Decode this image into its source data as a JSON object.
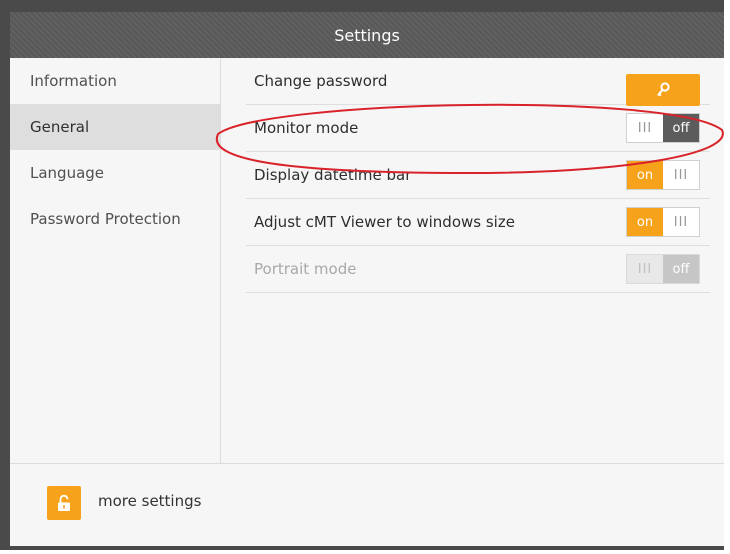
{
  "window": {
    "title": "Settings"
  },
  "sidebar": {
    "items": [
      {
        "label": "Information",
        "active": false
      },
      {
        "label": "General",
        "active": true
      },
      {
        "label": "Language",
        "active": false
      },
      {
        "label": "Password Protection",
        "active": false
      }
    ]
  },
  "settings": {
    "change_password": {
      "label": "Change password",
      "icon": "key-icon"
    },
    "monitor_mode": {
      "label": "Monitor mode",
      "grip": "III",
      "state": "off"
    },
    "display_datetime_bar": {
      "label": "Display datetime bar",
      "grip": "III",
      "state": "on"
    },
    "adjust_viewer": {
      "label": "Adjust cMT Viewer to windows size",
      "grip": "III",
      "state": "on"
    },
    "portrait_mode": {
      "label": "Portrait mode",
      "grip": "III",
      "state": "off",
      "disabled": true
    }
  },
  "footer": {
    "more_settings_label": "more settings",
    "icon": "unlock-icon"
  },
  "colors": {
    "accent": "#f7a21b",
    "toggle_off": "#5c5c5c",
    "annotation": "#d9232a"
  }
}
